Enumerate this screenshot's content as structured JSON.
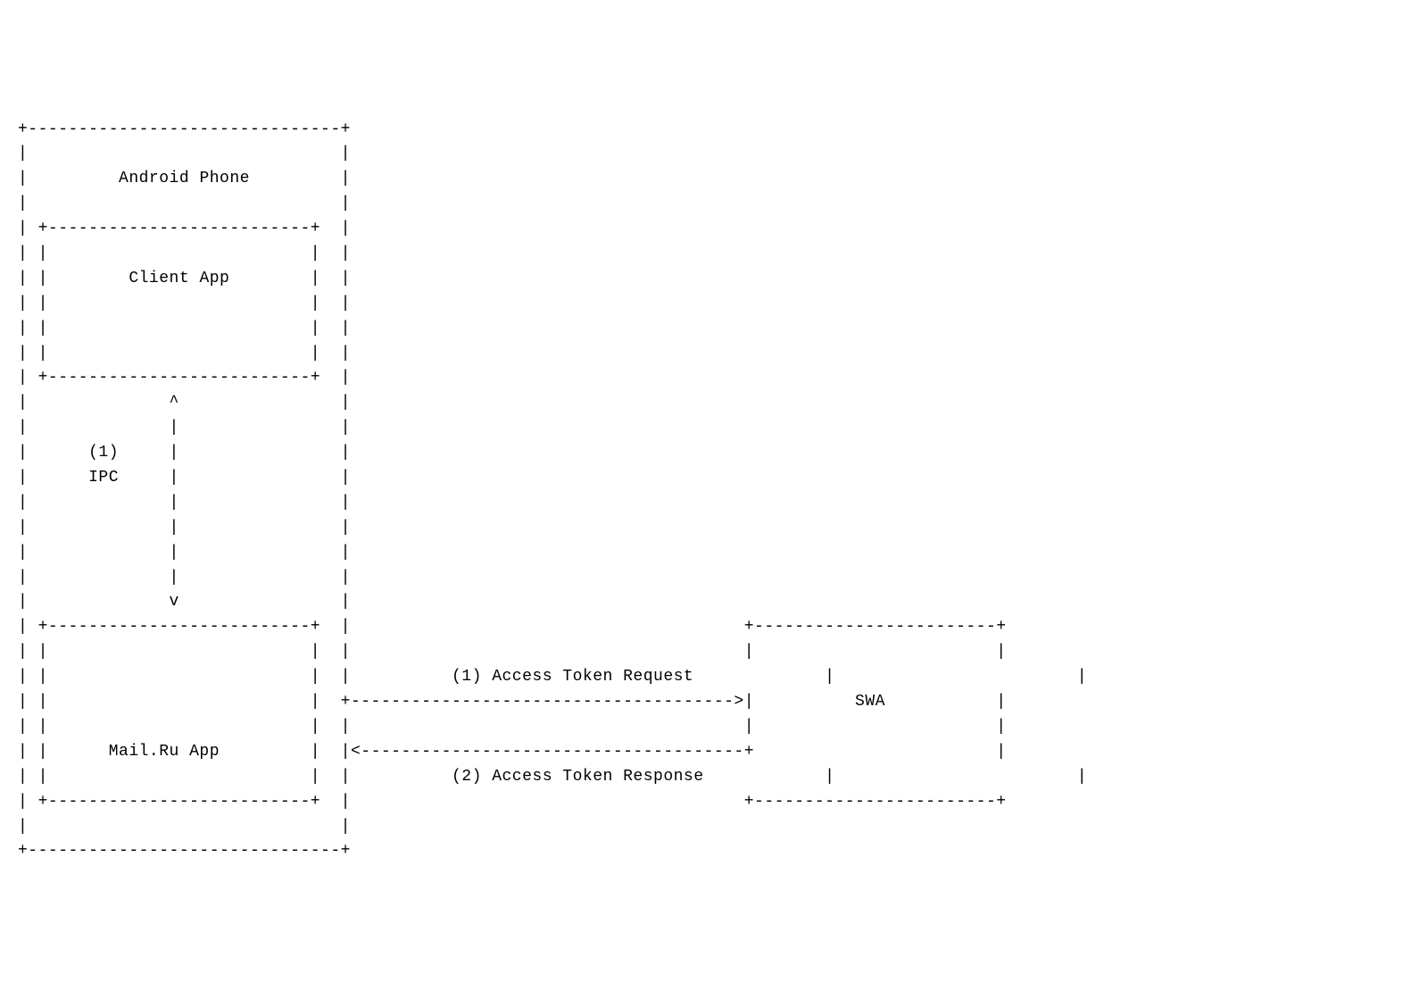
{
  "diagram": {
    "boxes": {
      "outer": "Android Phone",
      "client": "Client App",
      "mailru": "Mail.Ru App",
      "swa": "SWA"
    },
    "arrows": {
      "ipc_num": "(1)",
      "ipc_label": "IPC",
      "request": "(1) Access Token Request",
      "response": "(2) Access Token Response"
    }
  },
  "ascii": {
    "l01": "+-------------------------------+",
    "l02": "|                               |",
    "l03_a": "|         ",
    "l03_b": "         |",
    "l04": "|                               |",
    "l05": "| +--------------------------+  |",
    "l06": "| |                          |  |",
    "l07_a": "| |        ",
    "l07_b": "        |  |",
    "l08": "| |                          |  |",
    "l09": "| |                          |  |",
    "l10": "| |                          |  |",
    "l11": "| +--------------------------+  |",
    "l12": "|              ^                |",
    "l13": "|              |                |",
    "l14_a": "|      ",
    "l14_b": "     |                |",
    "l15_a": "|      ",
    "l15_b": "     |                |",
    "l16": "|              |                |",
    "l17": "|              |                |",
    "l18": "|              |                |",
    "l19": "|              |                |",
    "l20": "|              v                |",
    "l21_a": "| +--------------------------+  |",
    "l21_b": "                                       +------------------------+",
    "l22_a": "| |                          |  |",
    "l22_b": "                                       |                        |",
    "l23_a": "| |                          |  |          ",
    "l23_b": "             |                        |",
    "l24_a": "| |                          |  +-------------------------------------->|          ",
    "l24_b": "           |",
    "l25_a": "| |                          |  |",
    "l25_b": "                                       |                        |",
    "l26_a": "| |      ",
    "l26_b": "         |  |<--------------------------------------+                        |",
    "l27_a": "| |                          |  |          ",
    "l27_b": "            |                        |",
    "l28_a": "| +--------------------------+  |",
    "l28_b": "                                       +------------------------+",
    "l29": "|                               |",
    "l30": "+-------------------------------+"
  }
}
